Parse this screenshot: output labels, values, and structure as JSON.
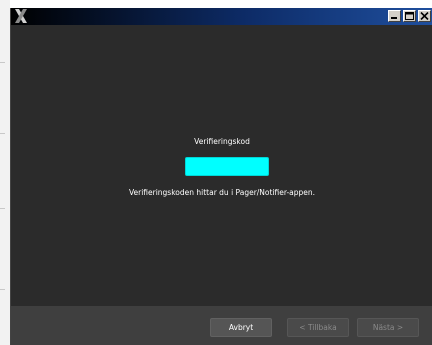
{
  "window": {
    "title": "",
    "app_icon": "x-logo-icon",
    "controls": [
      "minimize",
      "maximize",
      "close"
    ]
  },
  "main": {
    "heading": "Verifieringskod",
    "code_value": "",
    "hint": "Verifieringskoden hittar du i Pager/Notifier-appen."
  },
  "footer": {
    "cancel_label": "Avbryt",
    "back_label": "< Tillbaka",
    "next_label": "Nästa >"
  },
  "colors": {
    "background": "#2b2b2b",
    "footer": "#3f3f3f",
    "code_field": "#00ffff",
    "titlebar_start": "#000000",
    "titlebar_end": "#1f4f9e"
  }
}
